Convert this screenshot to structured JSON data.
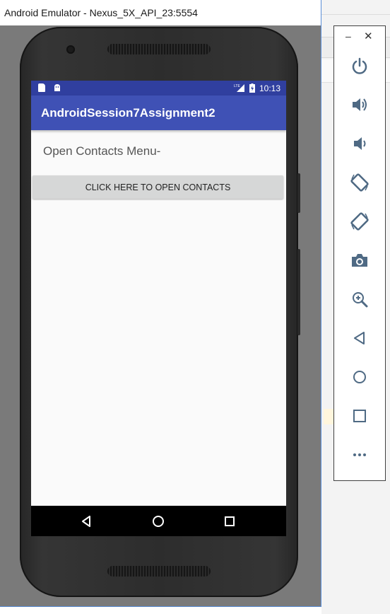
{
  "window": {
    "title": "Android Emulator - Nexus_5X_API_23:5554"
  },
  "status_bar": {
    "time": "10:13",
    "network": "LTE"
  },
  "app": {
    "title": "AndroidSession7Assignment2",
    "label": "Open Contacts Menu-",
    "button_label": "CLICK HERE TO OPEN CONTACTS"
  },
  "nav_bar": {
    "icons": [
      "back-icon",
      "home-icon",
      "recents-icon"
    ]
  },
  "control_panel": {
    "window_controls": {
      "minimize": "–",
      "close": "✕"
    },
    "buttons": [
      "power-icon",
      "volume-up-icon",
      "volume-down-icon",
      "rotate-left-icon",
      "rotate-right-icon",
      "camera-icon",
      "zoom-icon",
      "back-icon",
      "home-icon",
      "overview-icon",
      "more-icon"
    ]
  },
  "colors": {
    "status_bar": "#303f9f",
    "app_bar": "#3f51b5",
    "button": "#d6d7d7",
    "control_icon": "#4f6a84"
  }
}
